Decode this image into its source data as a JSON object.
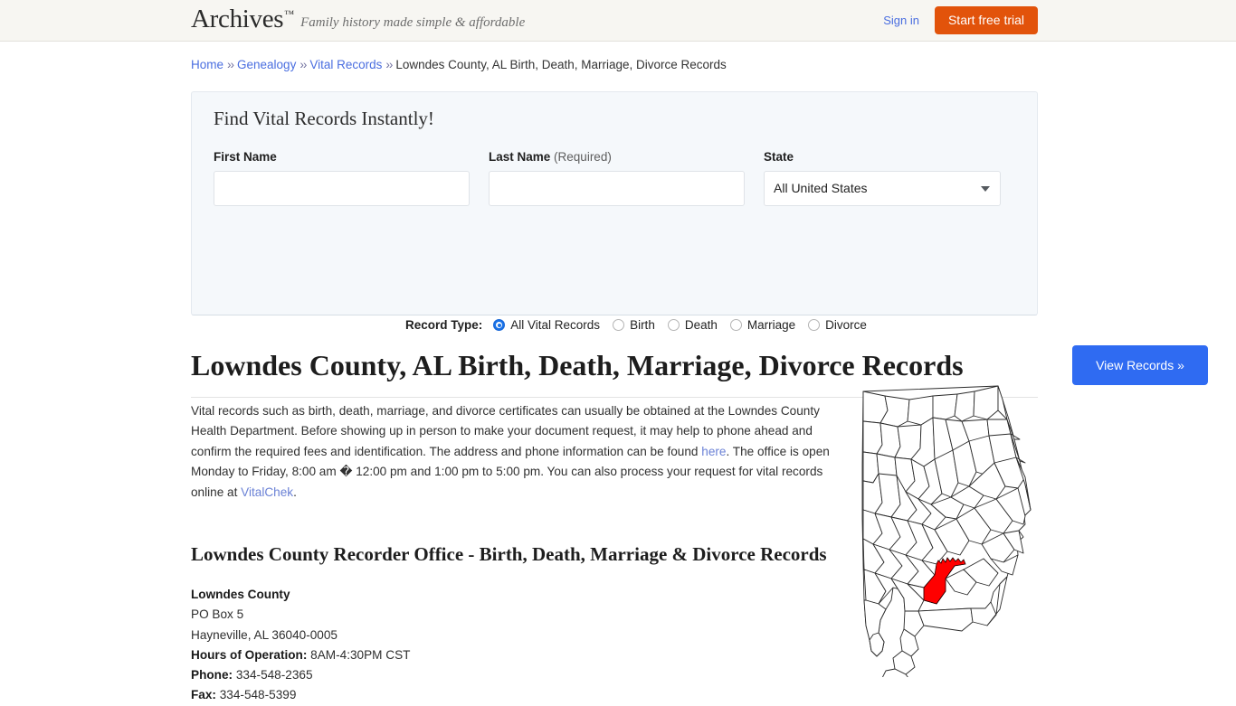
{
  "header": {
    "brand_name": "Archives",
    "brand_tm": "™",
    "tagline": "Family history made simple & affordable",
    "sign_in_label": "Sign in",
    "trial_button_label": "Start free trial",
    "background_color": "#f7f6f2",
    "trial_button_color": "#e2530b",
    "link_color": "#4a6ee0"
  },
  "breadcrumb": {
    "separator": "››",
    "items": [
      {
        "label": "Home",
        "is_link": true
      },
      {
        "label": "Genealogy",
        "is_link": true
      },
      {
        "label": "Vital Records",
        "is_link": true
      },
      {
        "label": "Lowndes County, AL Birth, Death, Marriage, Divorce Records",
        "is_link": false
      }
    ]
  },
  "search_form": {
    "title": "Find Vital Records Instantly!",
    "first_name": {
      "label": "First Name",
      "value": "",
      "placeholder": ""
    },
    "last_name": {
      "label": "Last Name",
      "required_note": "(Required)",
      "value": "",
      "placeholder": ""
    },
    "state": {
      "label": "State",
      "selected": "All United States",
      "options": [
        "All United States"
      ]
    },
    "record_type": {
      "label": "Record Type:",
      "selected": "All Vital Records",
      "options": [
        {
          "label": "All Vital Records",
          "checked": true
        },
        {
          "label": "Birth",
          "checked": false
        },
        {
          "label": "Death",
          "checked": false
        },
        {
          "label": "Marriage",
          "checked": false
        },
        {
          "label": "Divorce",
          "checked": false
        }
      ]
    },
    "submit_label": "View Records »",
    "submit_color": "#2f6bf2",
    "panel_background": "#f5f8fb"
  },
  "main": {
    "page_title": "Lowndes County, AL Birth, Death, Marriage, Divorce Records",
    "intro": {
      "part1": "Vital records such as birth, death, marriage, and divorce certificates can usually be obtained at the Lowndes County Health Department. Before showing up in person to make your document request, it may help to phone ahead and confirm the required fees and identification. The address and phone information can be found ",
      "link1": "here",
      "part2": ". The office is open Monday to Friday, 8:00 am ",
      "mojibake": "�",
      "part3": " 12:00 pm and 1:00 pm to 5:00 pm. You can also process your request for vital records online at ",
      "link2": "VitalChek",
      "part4": "."
    },
    "section_heading": "Lowndes County Recorder Office - Birth, Death, Marriage & Divorce Records",
    "address": {
      "name": "Lowndes County",
      "street": "PO Box 5",
      "city_state_zip": "Hayneville, AL 36040-0005",
      "hours_label": "Hours of Operation:",
      "hours_value": "8AM-4:30PM CST",
      "phone_label": "Phone:",
      "phone_value": "334-548-2365",
      "fax_label": "Fax:",
      "fax_value": "334-548-5399"
    },
    "map": {
      "state": "Alabama",
      "highlighted_county": "Lowndes County",
      "highlight_color": "#FF0000",
      "outline_color": "#000000"
    }
  }
}
